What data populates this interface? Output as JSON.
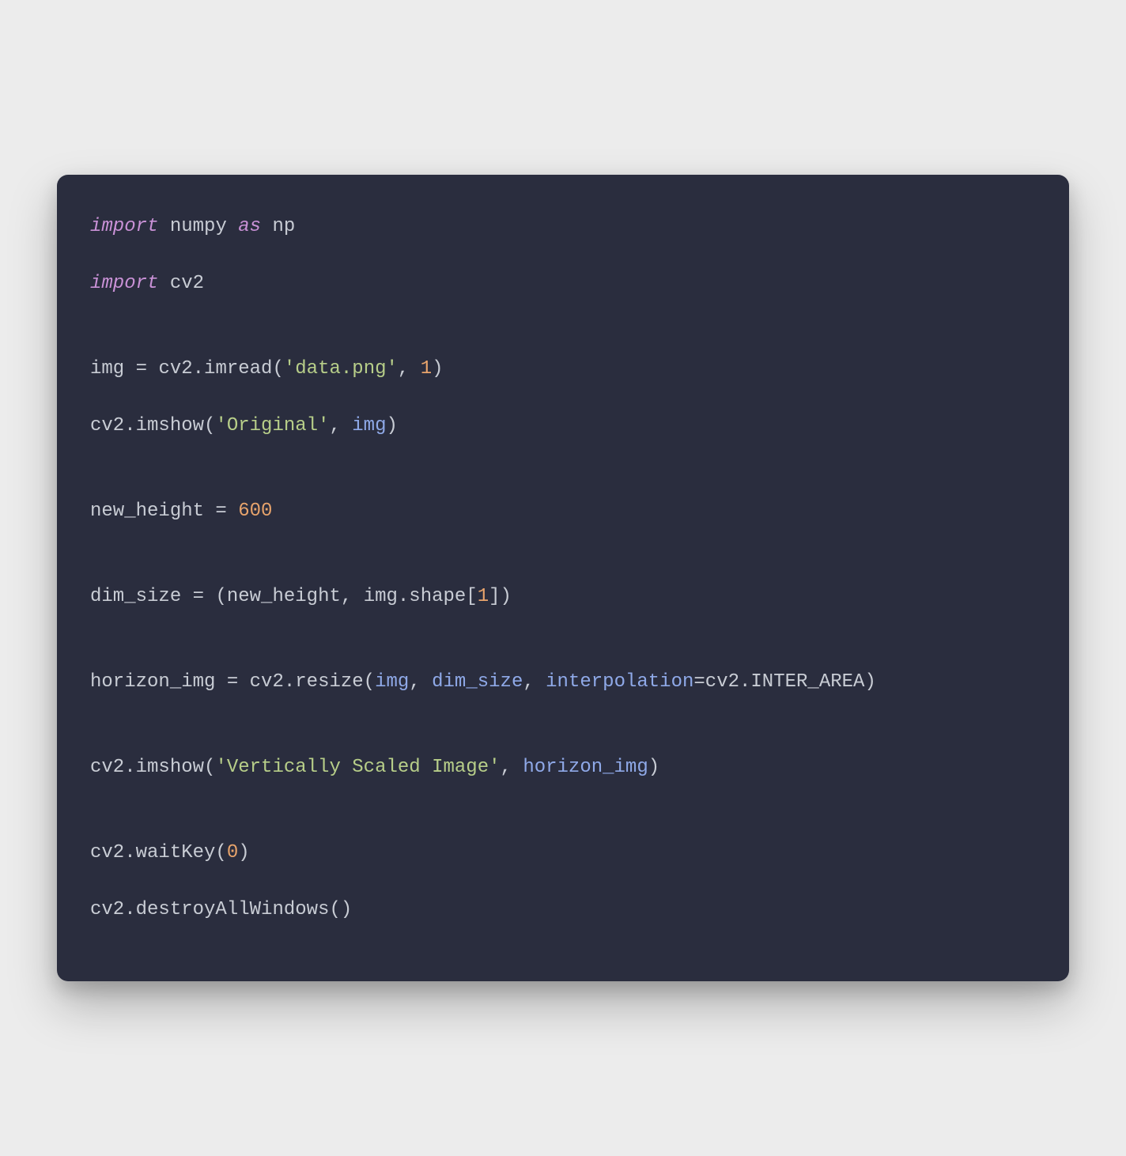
{
  "code": {
    "line1": {
      "import": "import",
      "numpy": "numpy",
      "as": "as",
      "np": "np"
    },
    "line2": {
      "import": "import",
      "cv2": "cv2"
    },
    "line3": {
      "img": "img",
      "eq": " = ",
      "cv2imread": "cv2.imread(",
      "str": "'data.png'",
      "comma": ", ",
      "num": "1",
      "close": ")"
    },
    "line4": {
      "cv2imshow": "cv2.imshow(",
      "str": "'Original'",
      "comma": ", ",
      "img": "img",
      "close": ")"
    },
    "line5": {
      "newheight": "new_height",
      "eq": " = ",
      "num": "600"
    },
    "line6": {
      "dimsize": "dim_size",
      "eq": " = ",
      "open": "(",
      "newheight": "new_height",
      "comma": ", ",
      "imgshape": "img.shape[",
      "num": "1",
      "close": "])"
    },
    "line7": {
      "horizon": "horizon_img",
      "eq": " = ",
      "cv2resize": "cv2.resize(",
      "img": "img",
      "comma1": ", ",
      "dimsize": "dim_size",
      "comma2": ", ",
      "interp": "interpolation",
      "eqarg": "=",
      "interarea": "cv2.INTER_AREA",
      "close": ")"
    },
    "line8": {
      "cv2imshow": "cv2.imshow(",
      "str": "'Vertically Scaled Image'",
      "comma": ", ",
      "horizon": "horizon_img",
      "close": ")"
    },
    "line9": {
      "waitkey": "cv2.waitKey(",
      "num": "0",
      "close": ")"
    },
    "line10": {
      "destroy": "cv2.destroyAllWindows()"
    }
  }
}
